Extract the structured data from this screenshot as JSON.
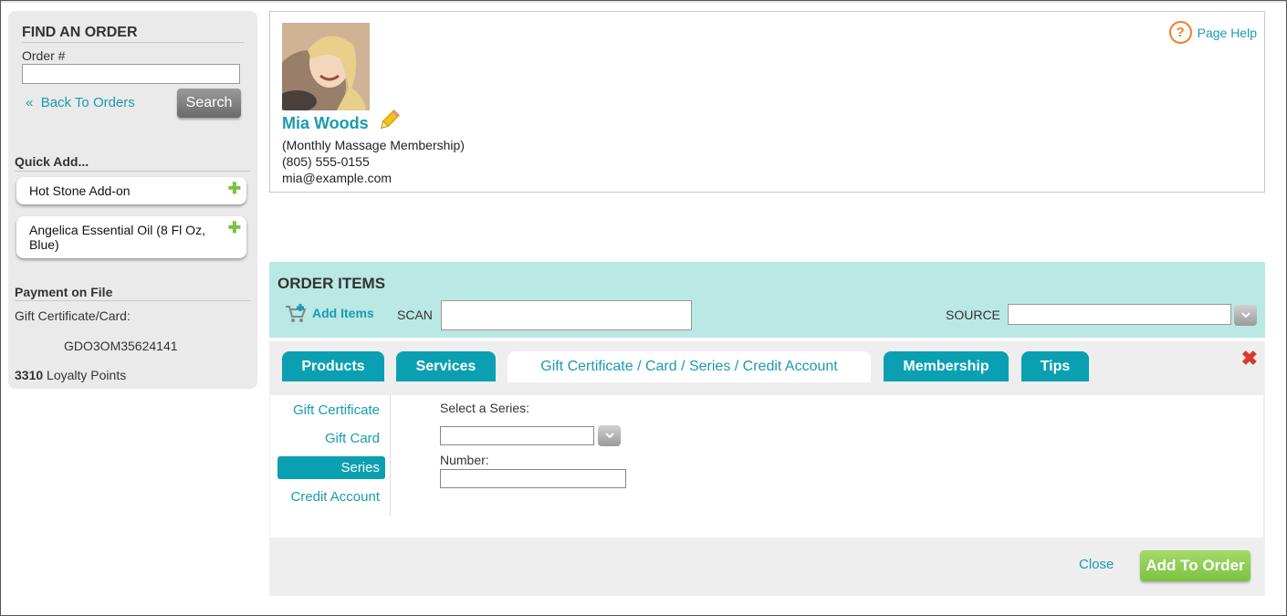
{
  "sidebar": {
    "find_title": "FIND AN ORDER",
    "order_label": "Order #",
    "order_value": "",
    "back_link": "Back To Orders",
    "back_chevron": "«",
    "search_label": "Search",
    "quick_add_title": "Quick Add...",
    "quick_items": [
      {
        "label": "Hot Stone Add-on"
      },
      {
        "label": "Angelica Essential Oil (8 Fl Oz, Blue)"
      }
    ],
    "payment_title": "Payment on File",
    "payment_label": "Gift Certificate/Card:",
    "payment_code": "GDO3OM35624141",
    "loyalty_points": "3310",
    "loyalty_label": "Loyalty Points"
  },
  "customer": {
    "name": "Mia Woods",
    "membership": "(Monthly Massage Membership)",
    "phone": "(805) 555-0155",
    "email": "mia@example.com",
    "page_help": "Page Help"
  },
  "order_items": {
    "title": "ORDER ITEMS",
    "add_items": "Add Items",
    "scan_label": "SCAN",
    "scan_value": "",
    "source_label": "SOURCE",
    "source_value": ""
  },
  "tabs": [
    {
      "label": "Products",
      "active": false
    },
    {
      "label": "Services",
      "active": false
    },
    {
      "label": "Gift Certificate / Card / Series / Credit Account",
      "active": true
    },
    {
      "label": "Membership",
      "active": false
    },
    {
      "label": "Tips",
      "active": false
    }
  ],
  "sub_nav": [
    {
      "label": "Gift Certificate",
      "active": false
    },
    {
      "label": "Gift Card",
      "active": false
    },
    {
      "label": "Series",
      "active": true
    },
    {
      "label": "Credit Account",
      "active": false
    }
  ],
  "form": {
    "series_label": "Select a Series:",
    "series_value": "",
    "number_label": "Number:",
    "number_value": ""
  },
  "footer": {
    "close_label": "Close",
    "add_to_order_label": "Add To Order"
  },
  "colors": {
    "accent": "#1a9bb0",
    "tab_bg": "#0aa0b2",
    "order_bar": "#b9e8e5",
    "add_button": "#7cc241",
    "help_icon": "#f07f2a",
    "close_icon": "#d9392f"
  }
}
